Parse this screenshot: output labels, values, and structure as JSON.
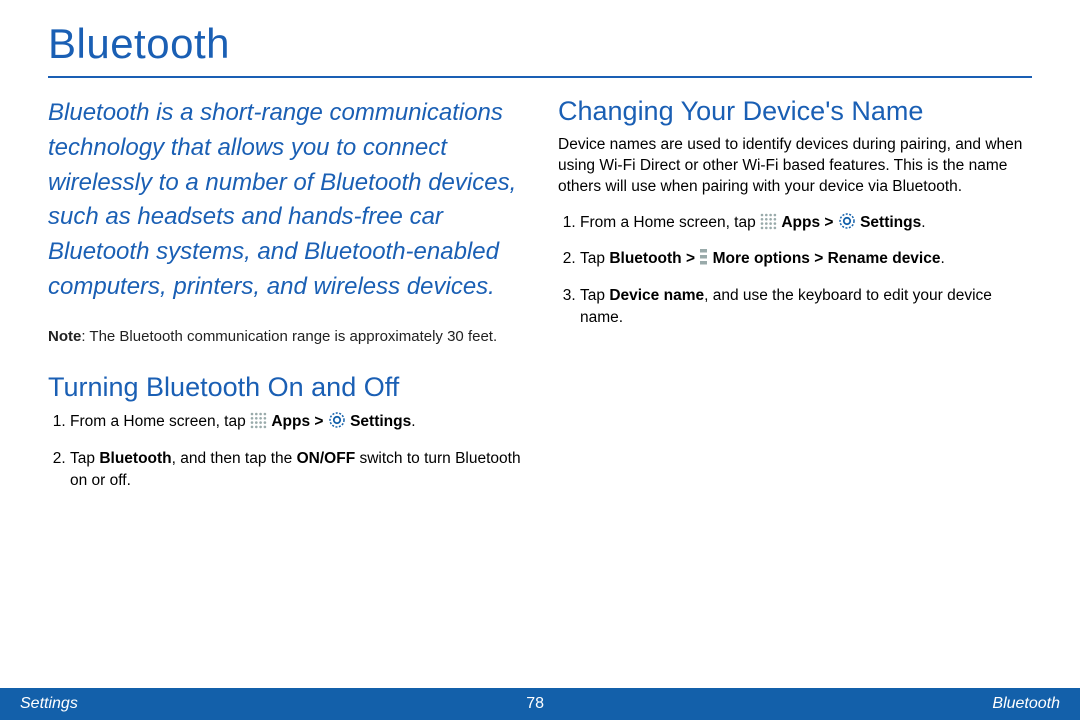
{
  "title": "Bluetooth",
  "intro": "Bluetooth is a short-range communications technology that allows you to connect wirelessly to a number of Bluetooth devices, such as headsets and hands-free car Bluetooth systems, and Bluetooth-enabled computers, printers, and wireless devices.",
  "note_label": "Note",
  "note_text": ": The Bluetooth communication range is approximately 30 feet.",
  "left": {
    "heading": "Turning Bluetooth On and Off",
    "step1_pre": "From a Home screen, tap ",
    "step1_apps": "Apps",
    "step1_gt": " > ",
    "step1_settings": "Settings",
    "step1_post": ".",
    "step2_a": "Tap ",
    "step2_b": "Bluetooth",
    "step2_c": ", and then tap the ",
    "step2_d": "ON/OFF",
    "step2_e": " switch to turn Bluetooth on or off."
  },
  "right": {
    "heading": "Changing Your Device's Name",
    "para": "Device names are used to identify devices during pairing, and when using Wi-Fi Direct or other Wi-Fi based features. This is the name others will use when pairing with your device via Bluetooth.",
    "step1_pre": "From a Home screen, tap ",
    "step1_apps": "Apps",
    "step1_gt": " > ",
    "step1_settings": "Settings",
    "step1_post": ".",
    "step2_a": "Tap ",
    "step2_b": "Bluetooth",
    "step2_c": " > ",
    "step2_d": "More options",
    "step2_e": " > ",
    "step2_f": "Rename device",
    "step2_g": ".",
    "step3_a": "Tap ",
    "step3_b": "Device name",
    "step3_c": ", and use the keyboard to edit your device name."
  },
  "footer": {
    "left": "Settings",
    "center": "78",
    "right": "Bluetooth"
  }
}
